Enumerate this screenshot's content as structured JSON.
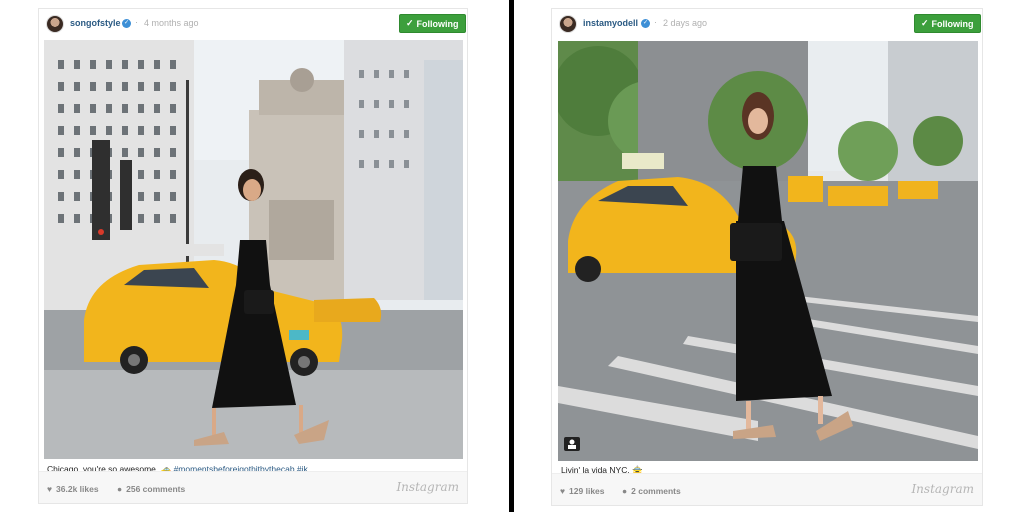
{
  "posts": [
    {
      "username": "songofstyle",
      "separator": "·",
      "time": "4 months ago",
      "follow_label": "Following",
      "caption_text": "Chicago, you're so awesome. ",
      "caption_emoji": "🚕",
      "caption_tags": "#momentsbeforeigothitbythecab #jk",
      "likes": "36.2k likes",
      "comments": "256 comments",
      "brand": "Instagram"
    },
    {
      "username": "instamyodell",
      "separator": "·",
      "time": "2 days ago",
      "follow_label": "Following",
      "caption_text": "Livin' la vida NYC. ",
      "caption_emoji": "🚖",
      "caption_tags": "",
      "likes": "129 likes",
      "comments": "2 comments",
      "brand": "Instagram"
    }
  ],
  "colors": {
    "follow_green": "#3c9f3c",
    "username_blue": "#2b5a83",
    "taxi_yellow": "#f2b51c"
  },
  "icons": [
    "verified-badge-icon",
    "check-icon",
    "heart-icon",
    "comment-icon",
    "photo-tag-icon"
  ]
}
